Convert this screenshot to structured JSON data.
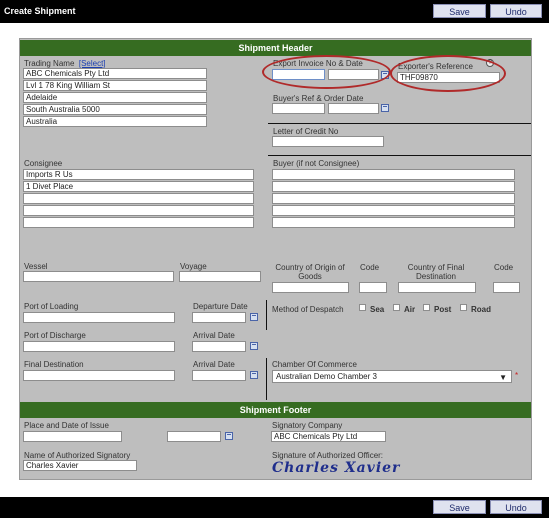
{
  "window_title": "Create Shipment",
  "toolbar": {
    "save_label": "Save",
    "undo_label": "Undo"
  },
  "header": {
    "title": "Shipment Header",
    "trading_name_label": "Trading Name",
    "select_link": "[Select]",
    "trading_name_lines": [
      "ABC Chemicals Pty Ltd",
      "Lvl 1 78 King William St",
      "Adelaide",
      "South Australia 5000",
      "Australia"
    ],
    "export_invoice_label": "Export Invoice No & Date",
    "export_invoice_no": "",
    "export_invoice_date": "",
    "exporters_reference_label": "Exporter's Reference",
    "exporters_reference_value": "THF09870",
    "help_icon_text": "?",
    "buyers_ref_label": "Buyer's Ref & Order Date",
    "letter_of_credit_label": "Letter of Credit No",
    "consignee_label": "Consignee",
    "consignee_lines": [
      "Imports R Us",
      "1 Divet Place",
      "",
      "",
      ""
    ],
    "buyer_label": "Buyer (if not Consignee)",
    "vessel_label": "Vessel",
    "voyage_label": "Voyage",
    "country_origin_label": "Country of Origin of Goods",
    "code_label": "Code",
    "country_final_label": "Country of Final Destination",
    "port_loading_label": "Port of Loading",
    "departure_date_label": "Departure Date",
    "method_despatch_label": "Method of Despatch",
    "despatch_options": [
      "Sea",
      "Air",
      "Post",
      "Road"
    ],
    "port_discharge_label": "Port of Discharge",
    "arrival_date_label": "Arrival Date",
    "final_destination_label": "Final Destination",
    "chamber_label": "Chamber Of Commerce",
    "chamber_value": "Australian Demo Chamber 3",
    "required_marker": "*"
  },
  "footer": {
    "title": "Shipment Footer",
    "place_date_label": "Place and Date of Issue",
    "signatory_company_label": "Signatory Company",
    "signatory_company_value": "ABC Chemicals Pty Ltd",
    "authorized_name_label": "Name of Authorized Signatory",
    "authorized_name_value": "Charles Xavier",
    "signature_label": "Signature of Authorized Officer:",
    "signature_text": "Charles Xavier"
  },
  "colors": {
    "section_header": "#366c21",
    "panel": "#bebebe",
    "highlight_ring": "#b02a2a",
    "bar": "#000000"
  },
  "icons": [
    "calendar-icon",
    "help-icon",
    "dropdown-arrow-icon"
  ]
}
